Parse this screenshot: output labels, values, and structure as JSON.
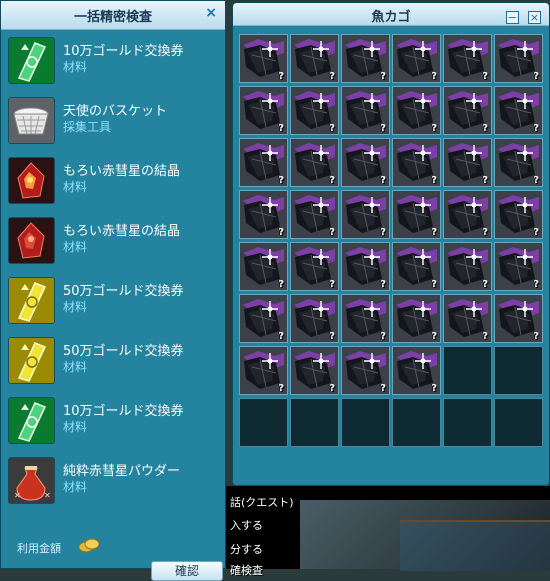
{
  "left_panel": {
    "title": "一括精密検査",
    "close_icon": "×",
    "items": [
      {
        "name": "10万ゴールド交換券",
        "category": "材料",
        "icon": "voucher-green"
      },
      {
        "name": "天使のバスケット",
        "category": "採集工具",
        "icon": "basket"
      },
      {
        "name": "もろい赤彗星の結晶",
        "category": "材料",
        "icon": "crystal"
      },
      {
        "name": "もろい赤彗星の結晶",
        "category": "材料",
        "icon": "crystal"
      },
      {
        "name": "50万ゴールド交換券",
        "category": "材料",
        "icon": "voucher-gold"
      },
      {
        "name": "50万ゴールド交換券",
        "category": "材料",
        "icon": "voucher-gold"
      },
      {
        "name": "10万ゴールド交換券",
        "category": "材料",
        "icon": "voucher-green"
      },
      {
        "name": "純粋赤彗星パウダー",
        "category": "材料",
        "icon": "powder"
      }
    ],
    "fee_label": "利用金額",
    "confirm_label": "確認"
  },
  "right_panel": {
    "title": "魚カゴ",
    "minimize_icon": "−",
    "close_icon": "×",
    "slot_total": 48,
    "filled_count": 40,
    "unknown_mark": "?"
  },
  "chat": {
    "lines": [
      "話(クエスト)",
      "入する",
      "分する",
      "確検査"
    ]
  },
  "colors": {
    "panel_bg": "#24839f",
    "header_bg": "#d4ebf5",
    "category_text": "#8fe0ff"
  }
}
